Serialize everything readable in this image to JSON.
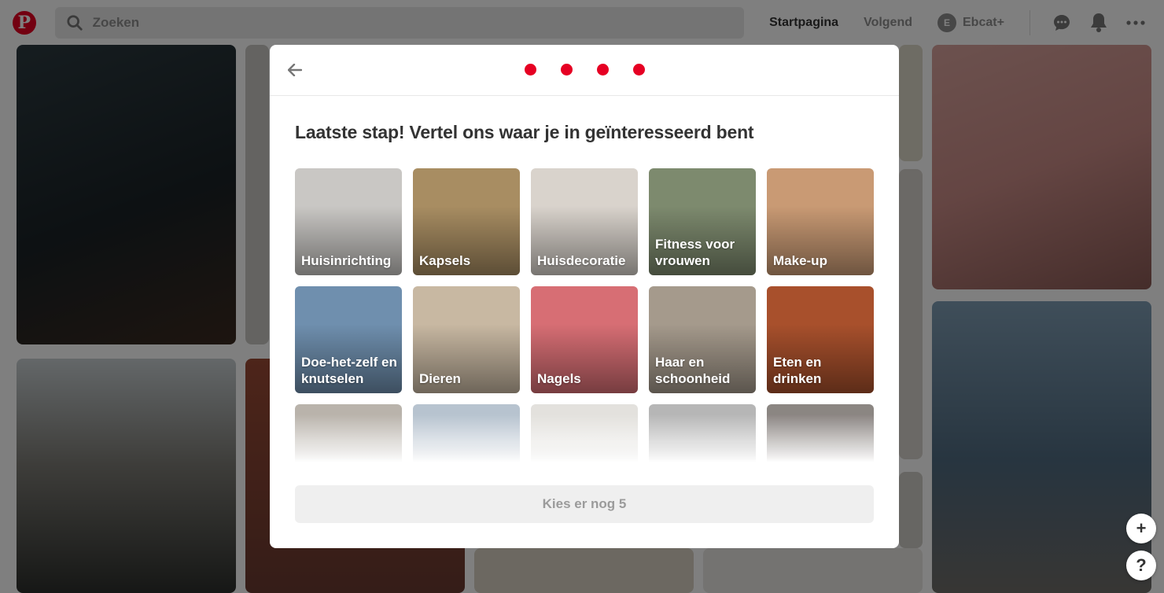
{
  "header": {
    "logo_letter": "P",
    "search_placeholder": "Zoeken",
    "nav": [
      "Startpagina",
      "Volgend"
    ],
    "user_initial": "E",
    "user_name": "Ebcat+",
    "icons": [
      "chat-icon",
      "bell-icon",
      "more-icon"
    ]
  },
  "colors": {
    "brand": "#e60023",
    "overlay": "rgba(0,0,0,0.5)"
  },
  "modal": {
    "step_count": 4,
    "title": "Laatste stap! Vertel ons waar je in geïnteresseerd bent",
    "topics": [
      {
        "label": "Huisinrichting",
        "color": "#c9c7c4"
      },
      {
        "label": "Kapsels",
        "color": "#a88d62"
      },
      {
        "label": "Huisdecoratie",
        "color": "#d9d3cc"
      },
      {
        "label": "Fitness voor vrouwen",
        "color": "#7d8a6e"
      },
      {
        "label": "Make-up",
        "color": "#c99a74"
      },
      {
        "label": "Doe-het-zelf en knutselen",
        "color": "#6f8fae"
      },
      {
        "label": "Dieren",
        "color": "#c8b8a2"
      },
      {
        "label": "Nagels",
        "color": "#d76e74"
      },
      {
        "label": "Haar en schoonheid",
        "color": "#a59a8c"
      },
      {
        "label": "Eten en drinken",
        "color": "#a8502c"
      },
      {
        "label": "",
        "color": "#b9b3ab"
      },
      {
        "label": "",
        "color": "#b7c3cf"
      },
      {
        "label": "",
        "color": "#e3e1dd"
      },
      {
        "label": "",
        "color": "#b6b6b6"
      },
      {
        "label": "",
        "color": "#8b8682"
      }
    ],
    "cta_label": "Kies er nog 5"
  },
  "fab": {
    "add": "+",
    "help": "?"
  }
}
